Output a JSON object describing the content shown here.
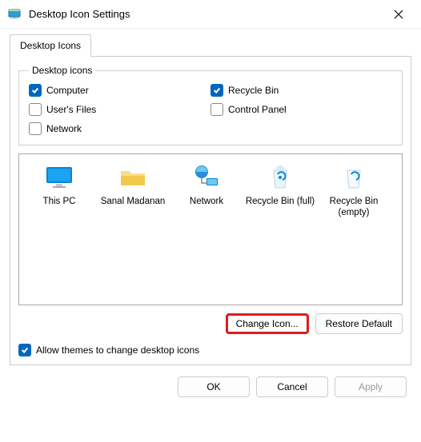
{
  "title": "Desktop Icon Settings",
  "tab": "Desktop Icons",
  "group_label": "Desktop icons",
  "checkboxes": {
    "computer": {
      "label": "Computer",
      "checked": true
    },
    "recycle": {
      "label": "Recycle Bin",
      "checked": true
    },
    "userfiles": {
      "label": "User's Files",
      "checked": false
    },
    "controlpanel": {
      "label": "Control Panel",
      "checked": false
    },
    "network": {
      "label": "Network",
      "checked": false
    }
  },
  "icons": [
    {
      "label": "This PC"
    },
    {
      "label": "Sanal Madanan"
    },
    {
      "label": "Network"
    },
    {
      "label": "Recycle Bin (full)"
    },
    {
      "label": "Recycle Bin (empty)"
    }
  ],
  "buttons": {
    "change_icon": "Change Icon...",
    "restore_default": "Restore Default"
  },
  "themes_checkbox": {
    "label": "Allow themes to change desktop icons",
    "checked": true
  },
  "footer": {
    "ok": "OK",
    "cancel": "Cancel",
    "apply": "Apply"
  }
}
